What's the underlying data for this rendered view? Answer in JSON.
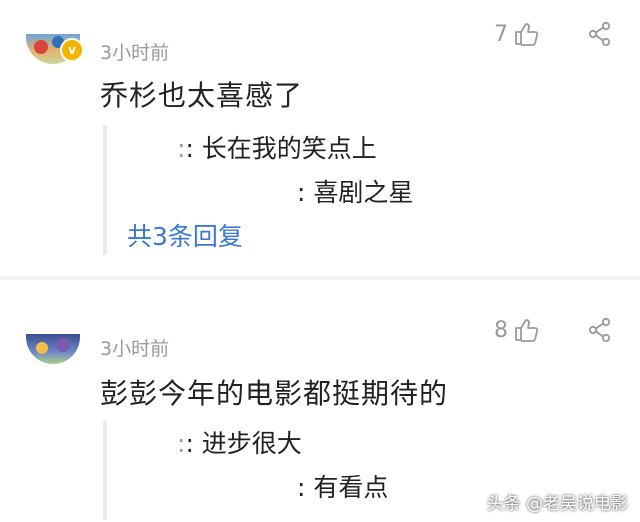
{
  "comments": [
    {
      "time": "3小时前",
      "likes": "7",
      "text": "乔杉也太喜感了",
      "replies": [
        {
          "user": ":",
          "text": ": 长在我的笑点上"
        },
        {
          "user": "",
          "text": ": 喜剧之星"
        }
      ],
      "more_replies": "共3条回复",
      "verified_badge": "v"
    },
    {
      "time": "3小时前",
      "likes": "8",
      "text": "彭彭今年的电影都挺期待的",
      "replies": [
        {
          "user": ":",
          "text": ": 进步很大"
        },
        {
          "user": "",
          "text": ": 有看点"
        }
      ]
    }
  ],
  "watermark": "头条 @老吴说电影",
  "colors": {
    "link": "#3b78d4",
    "muted": "#9a9a9a",
    "badge": "#f2b600"
  }
}
